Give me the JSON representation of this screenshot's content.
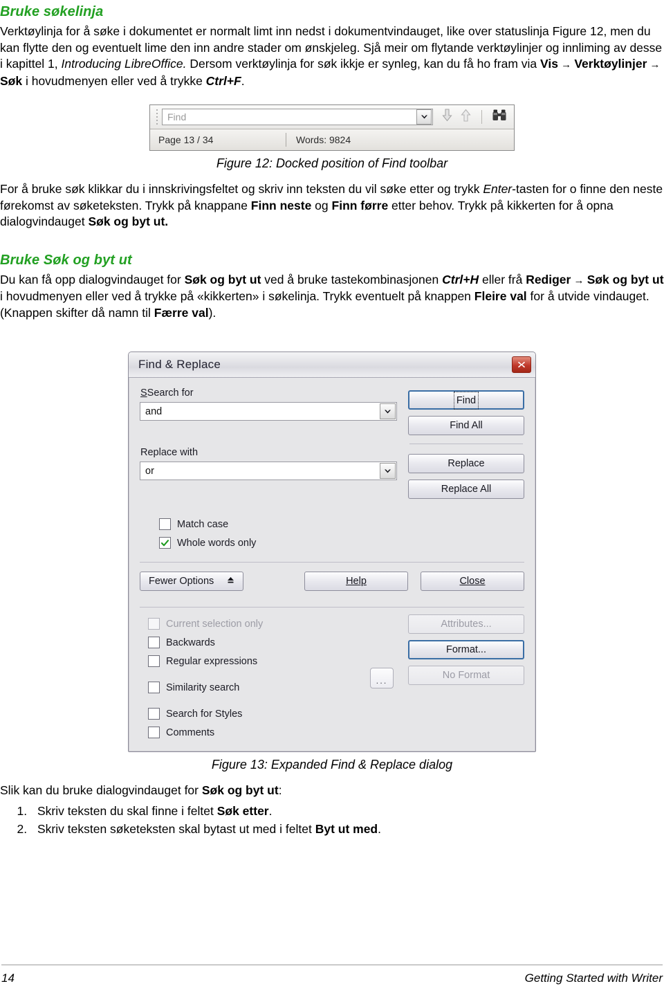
{
  "heading1": "Bruke søkelinja",
  "para1": {
    "s1": "Verktøylinja for å søke i dokumentet er normalt limt inn nedst i dokumentvindauget, like over statuslinja  Figure 12, men du kan flytte den og eventuelt lime den inn andre stader om ønskjeleg. Sjå meir om flytande verktøylinjer og innliming av desse i kapittel 1, ",
    "em1": "Introducing LibreOffice.",
    "s2": " Dersom verktøylinja for søk ikkje er synleg, kan du få ho fram via ",
    "b1": "Vis",
    "arrow1": " → ",
    "b2": "Verktøylinjer",
    "arrow2": " → ",
    "b3": "Søk",
    "s3": " i hovudmenyen eller ved å trykke ",
    "em2": "Ctrl+F",
    "s4": "."
  },
  "find_toolbar": {
    "search_placeholder": "Find",
    "dropdown_icon": "chevron-down-icon",
    "find_next_icon": "arrow-down-icon",
    "find_previous_icon": "arrow-up-icon",
    "find_replace_icon": "binoculars-icon",
    "status_page": "Page 13 / 34",
    "status_words": "Words: 9824"
  },
  "caption12": "Figure 12: Docked position of Find toolbar",
  "para2": {
    "s1": "For å bruke søk klikkar du i innskrivingsfeltet og skriv inn teksten du vil søke etter og trykk ",
    "em1": "Enter",
    "s2": "-tasten for o finne den neste førekomst av søketeksten. Trykk på knappane ",
    "b1": "Finn neste",
    "s3": " og ",
    "b2": "Finn førre",
    "s4": " etter behov. Trykk på kikkerten for å opna dialogvindauget ",
    "b3": "Søk og byt ut."
  },
  "heading2": "Bruke Søk og byt ut",
  "para3": {
    "s1": "Du kan få opp dialogvindauget for ",
    "b1": "Søk og byt ut",
    "s2": " ved å bruke tastekombinasjonen ",
    "em1": "Ctrl+H",
    "s3": " eller frå ",
    "b2": "Rediger",
    "arrow1": " → ",
    "b3": "Søk og byt ut",
    "s4": " i hovudmenyen eller ved å trykke på «kikkerten» i søkelinja. Trykk eventuelt på knappen ",
    "b4": "Fleire val",
    "s5": " for å utvide vindauget. (Knappen skifter då namn til ",
    "b5": "Færre val",
    "s6": ")."
  },
  "find_replace_dialog": {
    "title": "Find & Replace",
    "close_icon": "close-icon",
    "search_for_label": "Search for",
    "search_for_value": "and",
    "replace_with_label": "Replace with",
    "replace_with_value": "or",
    "dropdown_icon": "chevron-down-icon",
    "buttons": {
      "find": "Find",
      "find_all": "Find All",
      "replace": "Replace",
      "replace_all": "Replace All",
      "fewer_options": "Fewer Options",
      "fewer_options_icon": "caret-up-icon",
      "help": "Help",
      "close": "Close",
      "attributes": "Attributes...",
      "format": "Format...",
      "no_format": "No Format",
      "ellipsis": "..."
    },
    "checkboxes": [
      {
        "label": "Match case",
        "checked": false,
        "disabled": false
      },
      {
        "label": "Whole words only",
        "checked": true,
        "disabled": false
      }
    ],
    "options": [
      {
        "label": "Current selection only",
        "checked": false,
        "disabled": true
      },
      {
        "label": "Backwards",
        "checked": false,
        "disabled": false
      },
      {
        "label": "Regular expressions",
        "checked": false,
        "disabled": false
      },
      {
        "label": "Similarity search",
        "checked": false,
        "disabled": false
      },
      {
        "label": "Search for Styles",
        "checked": false,
        "disabled": false
      },
      {
        "label": "Comments",
        "checked": false,
        "disabled": false
      }
    ],
    "check_color": "#1f9b20",
    "default_button_border": "#3a6ea5"
  },
  "caption13": "Figure 13: Expanded Find & Replace dialog",
  "para4": {
    "s1": "Slik kan du bruke dialogvindauget for ",
    "b1": "Søk og byt ut",
    "s2": ":"
  },
  "steps": [
    {
      "s1": "Skriv teksten du skal finne i feltet ",
      "b1": "Søk etter",
      "s2": "."
    },
    {
      "s1": "Skriv teksten søketeksten skal bytast ut med i feltet ",
      "b1": "Byt ut med",
      "s2": "."
    }
  ],
  "footer": {
    "page_number": "14",
    "book_title": "Getting Started with Writer"
  },
  "colors": {
    "heading_green": "#22a022"
  }
}
